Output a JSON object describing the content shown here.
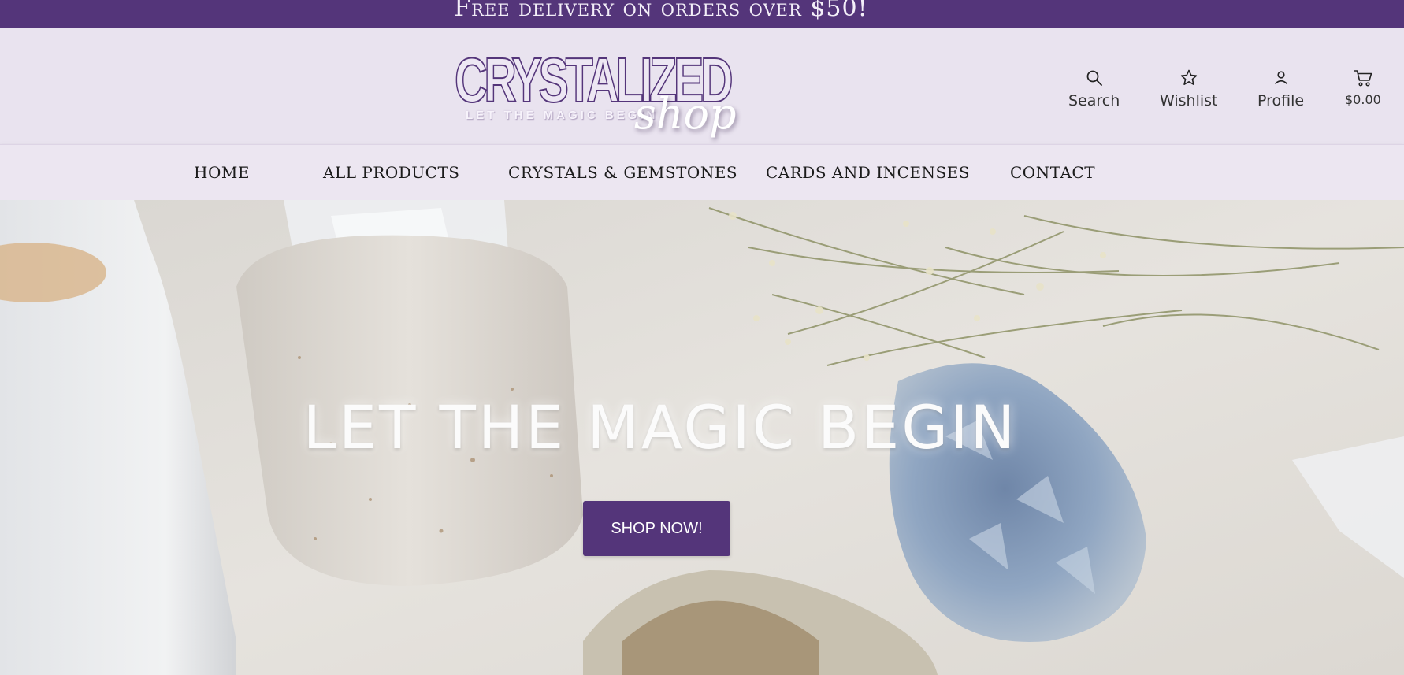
{
  "promo_bar": {
    "text": "Free delivery on orders over $50!"
  },
  "logo": {
    "main": "CRYSTALIZED",
    "tagline": "LET THE MAGIC BEGIN",
    "script": "shop"
  },
  "tools": {
    "search": {
      "label": "Search",
      "icon": "search-icon"
    },
    "wishlist": {
      "label": "Wishlist",
      "icon": "star-icon"
    },
    "profile": {
      "label": "Profile",
      "icon": "user-icon"
    },
    "cart": {
      "label": "$0.00",
      "icon": "cart-icon"
    }
  },
  "nav": {
    "items": [
      {
        "label": "HOME"
      },
      {
        "label": "ALL PRODUCTS"
      },
      {
        "label": "CRYSTALS & GEMSTONES"
      },
      {
        "label": "CARDS AND INCENSES"
      },
      {
        "label": "CONTACT"
      }
    ]
  },
  "hero": {
    "title": "LET THE MAGIC BEGIN",
    "button_label": "SHOP NOW!"
  },
  "colors": {
    "brand_purple": "#54357a",
    "header_bg": "#e9e3ef",
    "hero_bg": "#e3e0db"
  }
}
